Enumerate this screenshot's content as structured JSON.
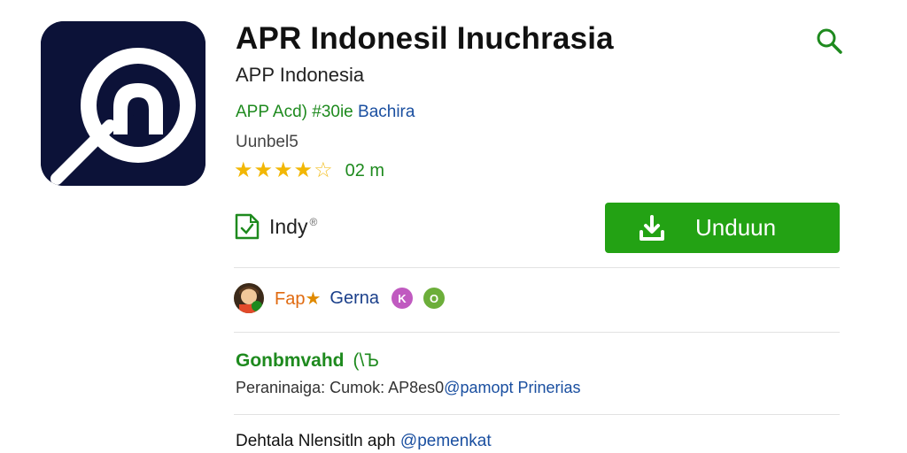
{
  "app": {
    "title": "APR Indonesil Inuchrasia",
    "subtitle": "APP Indonesia",
    "developer_name": "APP Acd) #30ie",
    "developer_category": "Bachira",
    "downloads_label": "Uunbel5",
    "rating_stars": 4.5,
    "rating_count": "02 m",
    "icon_name": "magnifier-logo-icon"
  },
  "badge": {
    "label": "Indy",
    "info_symbol": "®",
    "icon_name": "document-check-icon"
  },
  "install": {
    "label": "Unduun",
    "icon_name": "download-icon"
  },
  "tags": {
    "tag1": "Fap",
    "tag1_symbol": "★",
    "tag2": "Gerna",
    "purple_symbol": "K",
    "green_symbol": "O"
  },
  "section": {
    "title": "Gonbmvahd",
    "title_symbol": "(\\Ъ",
    "info_prefix": "Peraninaiga:",
    "info_mid": "Cumok:",
    "info_code": "AP8es0",
    "info_link": "@pamopt Prinerias"
  },
  "footer": {
    "text": "Dehtala Nlensitln aph",
    "link": "@pemenkat"
  },
  "colors": {
    "accent_green": "#23a214",
    "link_blue": "#1a4fa0",
    "icon_bg": "#0c1238",
    "star": "#f2b705"
  }
}
